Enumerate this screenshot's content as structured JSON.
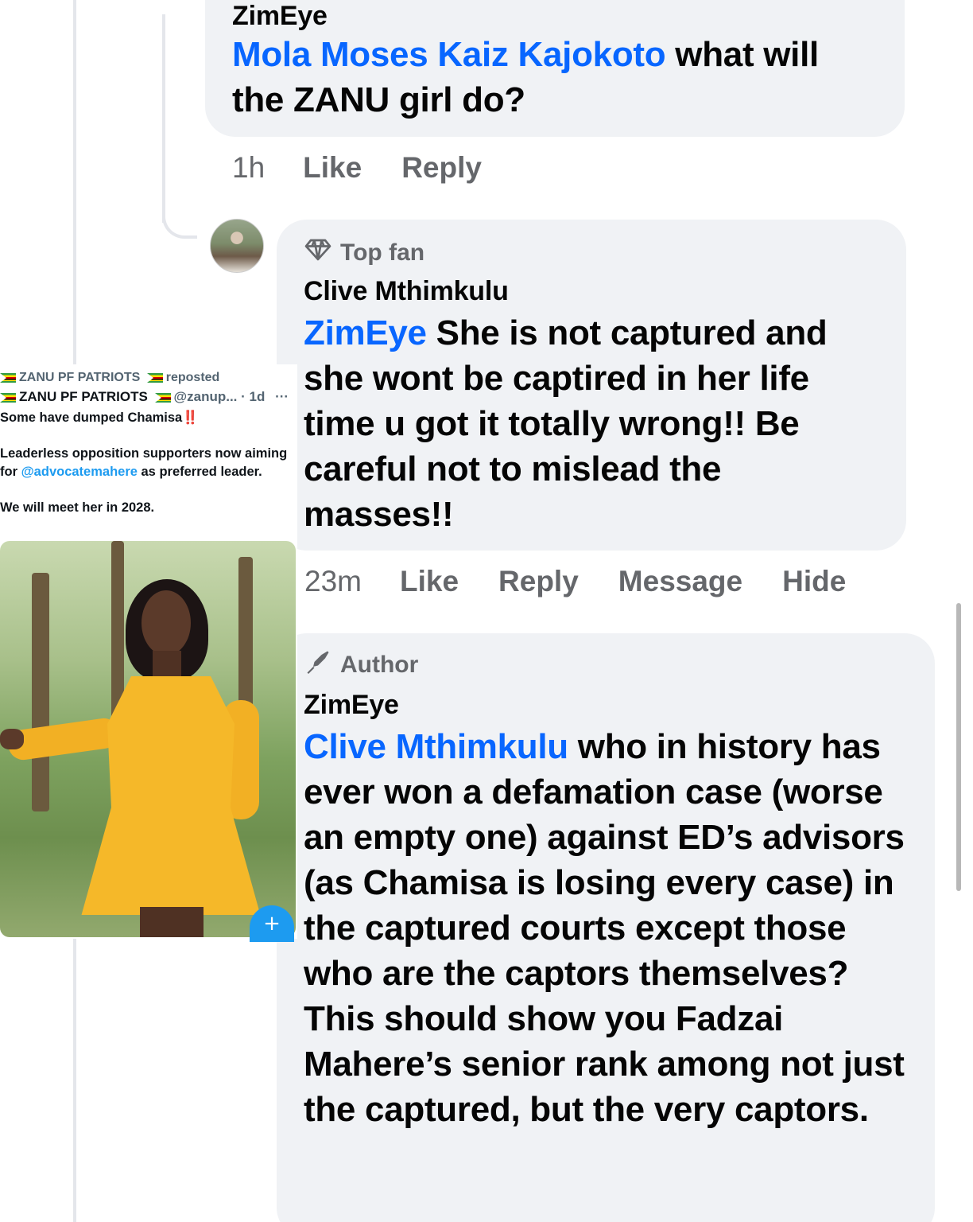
{
  "comments": [
    {
      "author": "ZimEye",
      "mention": "Mola Moses Kaiz Kajokoto",
      "text": " what will the ZANU girl do?",
      "actions": {
        "time": "1h",
        "like": "Like",
        "reply": "Reply"
      }
    },
    {
      "badge": "Top fan",
      "badge_icon": "diamond-icon",
      "author": "Clive Mthimkulu",
      "mention": "ZimEye",
      "text": " She is not captured and she wont be captired in her life time u got it totally wrong!! Be careful not to mislead the masses!!",
      "actions": {
        "time": "23m",
        "like": "Like",
        "reply": "Reply",
        "message": "Message",
        "hide": "Hide"
      }
    },
    {
      "badge": "Author",
      "badge_icon": "pen-icon",
      "author": "ZimEye",
      "mention": "Clive Mthimkulu",
      "text": " who in history has ever won a defamation case (worse an empty one) against ED’s advisors (as Chamisa is losing every case) in the captured courts except those who are the captors themselves? This should show you Fadzai Mahere’s senior rank among not just the captured, but the very captors."
    }
  ],
  "embed": {
    "repost_line": "ZANU PF PATRIOTS",
    "repost_suffix": "reposted",
    "account_name": "ZANU PF PATRIOTS",
    "handle": "@zanup... · 1d",
    "more": "···",
    "line1": "Some have dumped Chamisa",
    "line1_emoji": "‼️",
    "line2a": "Leaderless opposition supporters now aiming for ",
    "line2_mention": "@advocatemahere",
    "line2b": " as preferred leader.",
    "line3": "We will meet her in 2028.",
    "fab": "+"
  },
  "colors": {
    "mention": "#0866ff",
    "bubble": "#f0f2f5",
    "meta": "#65676b",
    "twitter_blue": "#1d9bf0"
  }
}
